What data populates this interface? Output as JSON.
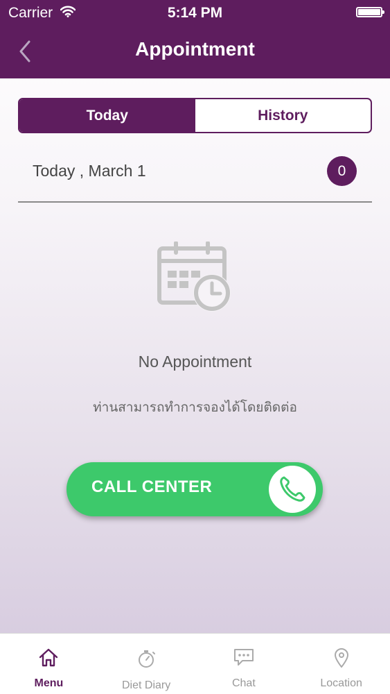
{
  "status_bar": {
    "carrier": "Carrier",
    "time": "5:14 PM"
  },
  "nav": {
    "title": "Appointment"
  },
  "segment": {
    "today_label": "Today",
    "history_label": "History",
    "selected": "Today"
  },
  "date_row": {
    "label": "Today , March 1",
    "count": "0"
  },
  "empty_state": {
    "icon": "calendar-clock-icon",
    "title": "No Appointment",
    "subtitle": "ท่านสามารถทำการจองได้โดยติดต่อ"
  },
  "call_button": {
    "label": "CALL CENTER",
    "icon": "phone-icon"
  },
  "tab_bar": {
    "items": [
      {
        "label": "Menu",
        "icon": "home-icon",
        "active": true
      },
      {
        "label": "Diet Diary",
        "icon": "stopwatch-icon",
        "active": false
      },
      {
        "label": "Chat",
        "icon": "chat-icon",
        "active": false
      },
      {
        "label": "Location",
        "icon": "location-pin-icon",
        "active": false
      }
    ]
  },
  "colors": {
    "brand": "#5e1d5e",
    "call": "#3dc96b",
    "inactive_icon": "#999999"
  }
}
